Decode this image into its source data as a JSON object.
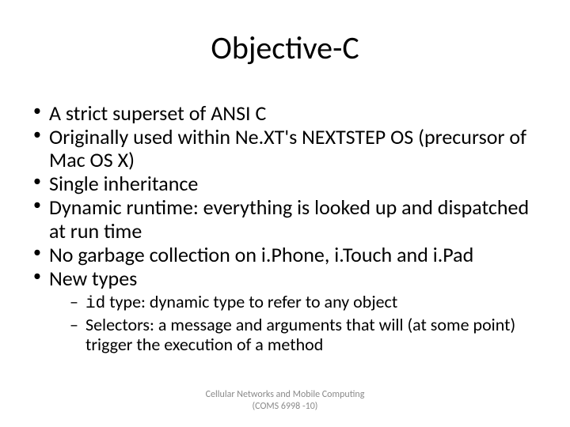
{
  "title": "Objective-C",
  "bullets": {
    "b0": "A strict superset of ANSI C",
    "b1": "Originally used within Ne.XT's NEXTSTEP OS (precursor of Mac OS X)",
    "b2": "Single inheritance",
    "b3": "Dynamic runtime: everything is looked up and dispatched at run time",
    "b4": "No garbage collection on i.Phone, i.Touch and i.Pad",
    "b5": "New types",
    "s0_prefix": "id",
    "s0_rest": " type: dynamic type to refer to any object",
    "s1": "Selectors: a message and arguments that will (at some point) trigger the execution of a method"
  },
  "footer": {
    "line1": "Cellular Networks and Mobile Computing",
    "line2": "(COMS 6998 -10)"
  }
}
